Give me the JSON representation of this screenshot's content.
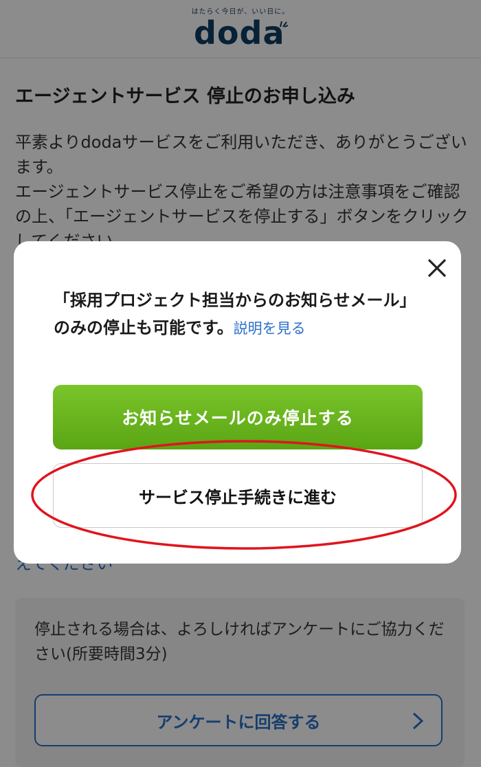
{
  "header": {
    "tagline": "はたらく今日が、いい日に。",
    "logo_text": "doda"
  },
  "main": {
    "title": "エージェントサービス 停止のお申し込み",
    "paragraphs": [
      "平素よりdodaサービスをご利用いただき、ありがとうございます。",
      "エージェントサービス停止をご希望の方は注意事項をご確認の上、「エージェントサービスを停止する」ボタンをクリックしてください。"
    ],
    "lower_text": "えてください"
  },
  "survey": {
    "text": "停止される場合は、よろしければアンケートにご協力ください(所要時間3分)",
    "button_label": "アンケートに回答する"
  },
  "modal": {
    "message": "「採用プロジェクト担当からのお知らせメール」のみの停止も可能です。",
    "explain_link": "説明を見る",
    "primary_button": "お知らせメールのみ停止する",
    "secondary_button": "サービス停止手続きに進む"
  },
  "colors": {
    "brand_navy": "#0d3d63",
    "accent_green": "#6bb51f",
    "link_blue": "#2a6fc9",
    "annotation_red": "#e0141e"
  }
}
